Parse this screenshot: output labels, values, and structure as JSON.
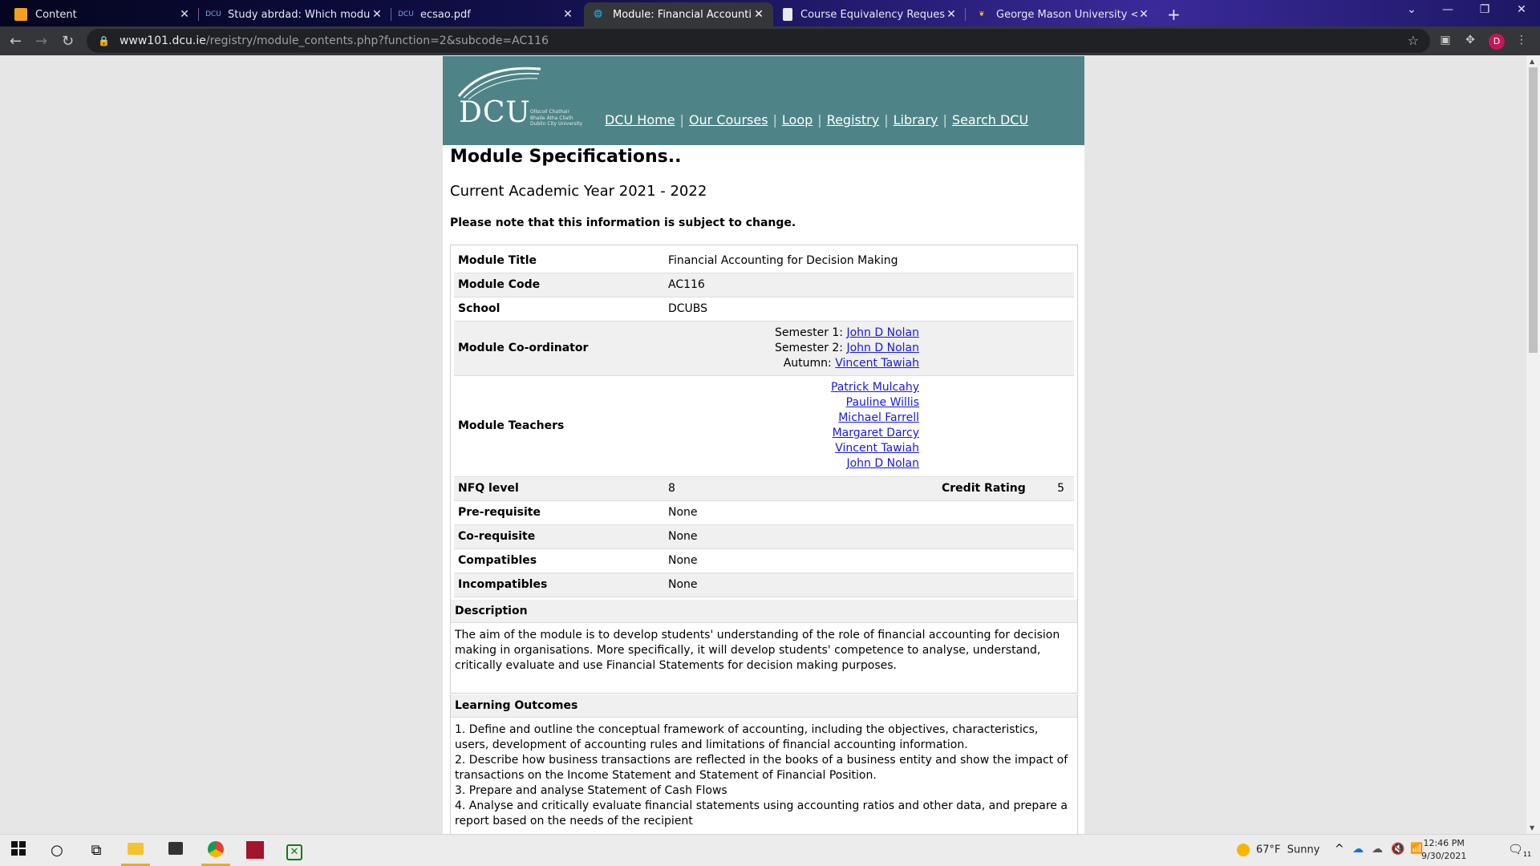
{
  "browser": {
    "tabs": [
      {
        "title": "Content",
        "icon": "notebook-icon",
        "active": false
      },
      {
        "title": "Study abrdad: Which modules ca",
        "icon": "dcu-icon",
        "active": false
      },
      {
        "title": "ecsao.pdf",
        "icon": "dcu-icon",
        "active": false
      },
      {
        "title": "Module: Financial Accounting for",
        "icon": "globe-icon",
        "active": true
      },
      {
        "title": "Course Equivalency Request - Cb",
        "icon": "document-icon",
        "active": false
      },
      {
        "title": "George Mason University < Geo",
        "icon": "gmu-icon",
        "active": false
      }
    ],
    "url_host": "www101.dcu.ie",
    "url_path": "/registry/module_contents.php?function=2&subcode=AC116",
    "profile_initial": "D"
  },
  "site": {
    "logo_text": "DCU",
    "logo_sub": [
      "Ollscoil Chathair",
      "Bhaile Átha Cliath",
      "Dublin City University"
    ],
    "nav": [
      "DCU Home",
      "Our Courses",
      "Loop",
      "Registry",
      "Library",
      "Search DCU"
    ]
  },
  "page": {
    "heading": "Module Specifications..",
    "year": "Current Academic Year 2021 - 2022",
    "note": "Please note that this information is subject to change."
  },
  "spec": {
    "title_label": "Module Title",
    "title_value": "Financial Accounting for Decision Making",
    "code_label": "Module Code",
    "code_value": "AC116",
    "school_label": "School",
    "school_value": "DCUBS",
    "coordinator_label": "Module Co-ordinator",
    "coordinators": [
      {
        "term": "Semester 1:",
        "name": "John D Nolan"
      },
      {
        "term": "Semester 2:",
        "name": "John D Nolan"
      },
      {
        "term": "Autumn:",
        "name": "Vincent Tawiah"
      }
    ],
    "teachers_label": "Module Teachers",
    "teachers": [
      "Patrick Mulcahy",
      "Pauline Willis",
      "Michael Farrell",
      "Margaret Darcy",
      "Vincent Tawiah",
      "John D Nolan"
    ],
    "nfq_label": "NFQ level",
    "nfq_value": "8",
    "credit_label": "Credit Rating",
    "credit_value": "5",
    "prereq_label": "Pre-requisite",
    "prereq_value": "None",
    "coreq_label": "Co-requisite",
    "coreq_value": "None",
    "compat_label": "Compatibles",
    "compat_value": "None",
    "incompat_label": "Incompatibles",
    "incompat_value": "None"
  },
  "description": {
    "heading": "Description",
    "text": "The aim of the module is to develop students' understanding of the role of financial accounting for decision making in organisations. More specifically, it will develop students' competence to analyse, understand, critically evaluate and use Financial Statements for decision making purposes."
  },
  "learning_outcomes": {
    "heading": "Learning Outcomes",
    "items": [
      "1. Define and outline the conceptual framework of accounting, including the objectives, characteristics, users, development of accounting rules and limitations of financial accounting information.",
      "2. Describe how business transactions are reflected in the books of a business entity and show the impact of transactions on the Income Statement and Statement of Financial Position.",
      "3. Prepare and analyse Statement of Cash Flows",
      "4. Analyse and critically evaluate financial statements using accounting ratios and other data, and prepare a report based on the needs of the recipient"
    ]
  },
  "taskbar": {
    "weather_temp": "67°F",
    "weather_text": "Sunny",
    "time": "12:46 PM",
    "date": "9/30/2021",
    "notification_count": "11"
  }
}
